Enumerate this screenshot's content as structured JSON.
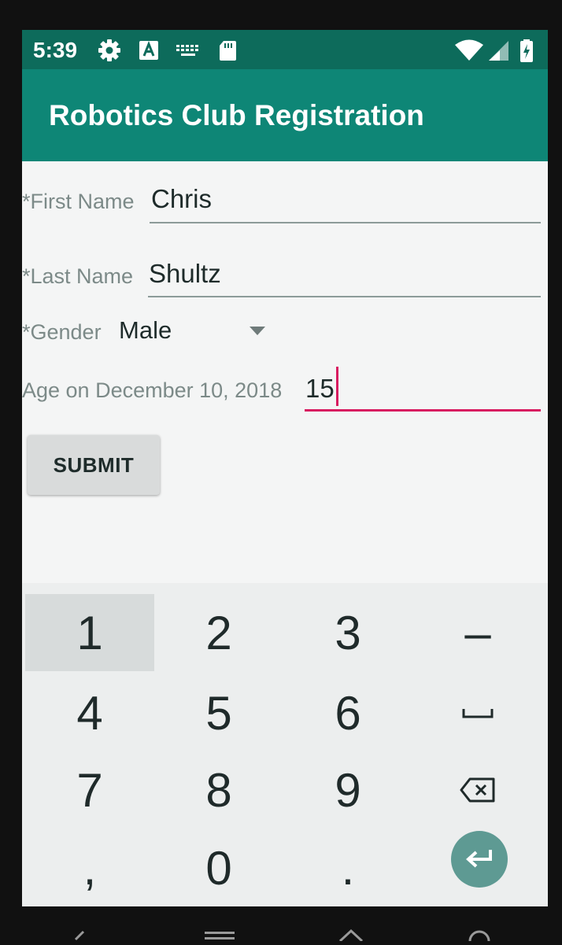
{
  "status_bar": {
    "time": "5:39",
    "icons": [
      "gear-icon",
      "text-a-icon",
      "keyboard-icon",
      "sd-card-icon",
      "wifi-icon",
      "signal-icon",
      "battery-charging-icon"
    ]
  },
  "app_bar": {
    "title": "Robotics Club Registration"
  },
  "form": {
    "first_name": {
      "label": "*First Name",
      "value": "Chris"
    },
    "last_name": {
      "label": "*Last Name",
      "value": "Shultz"
    },
    "gender": {
      "label": "*Gender",
      "value": "Male"
    },
    "age": {
      "label": "Age on December 10, 2018",
      "value": "15"
    },
    "submit_label": "SUBMIT"
  },
  "keyboard": {
    "rows": [
      [
        "1",
        "2",
        "3",
        "–"
      ],
      [
        "4",
        "5",
        "6",
        "space"
      ],
      [
        "7",
        "8",
        "9",
        "backspace"
      ],
      [
        ",",
        "0",
        ".",
        "enter"
      ]
    ],
    "pressed_key": "1"
  },
  "colors": {
    "status_bar": "#0d6b5b",
    "app_bar": "#0e8676",
    "accent": "#d81b60",
    "enter_key": "#5e9a93"
  }
}
